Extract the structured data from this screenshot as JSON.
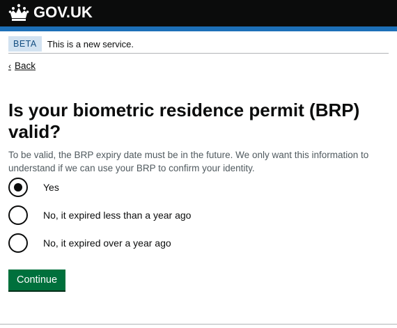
{
  "header": {
    "brand": "GOV.UK",
    "logo_icon": "crown-icon"
  },
  "phase_banner": {
    "tag": "BETA",
    "text": "This is a new service."
  },
  "back_link": {
    "label": "Back"
  },
  "question": {
    "title": "Is your biometric residence permit (BRP) valid?",
    "hint": "To be valid, the BRP expiry date must be in the future. We only want this information to understand if we can use your BRP to confirm your identity."
  },
  "options": [
    {
      "label": "Yes",
      "checked": true
    },
    {
      "label": "No, it expired less than a year ago",
      "checked": false
    },
    {
      "label": "No, it expired over a year ago",
      "checked": false
    }
  ],
  "continue_button": {
    "label": "Continue"
  },
  "colors": {
    "header": "#0b0c0c",
    "header_stripe": "#1d70b8",
    "button": "#00703c",
    "tag_bg": "#d2e2f1"
  }
}
